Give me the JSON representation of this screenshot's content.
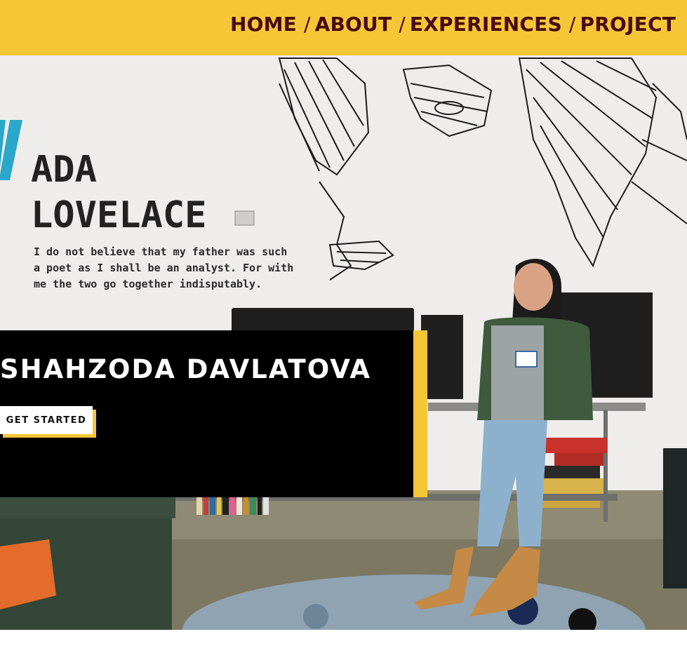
{
  "nav": {
    "items": [
      {
        "label": "HOME"
      },
      {
        "label": "ABOUT"
      },
      {
        "label": "EXPERIENCES"
      },
      {
        "label": "PROJECT"
      }
    ],
    "separator": "/"
  },
  "hero": {
    "mural": {
      "title_line1": "ADA",
      "title_line2": "LOVELACE",
      "quote_line1": "I do not believe that my father was such",
      "quote_line2": "a poet as I shall be an analyst. For with",
      "quote_line3": "me the two go together indisputably."
    },
    "name": "SHAHZODA DAVLATOVA",
    "cta_label": "GET STARTED"
  },
  "colors": {
    "accent_yellow": "#f5c636",
    "nav_text": "#4a0a0d",
    "card_bg": "#000000",
    "cta_bg": "#ffffff"
  }
}
